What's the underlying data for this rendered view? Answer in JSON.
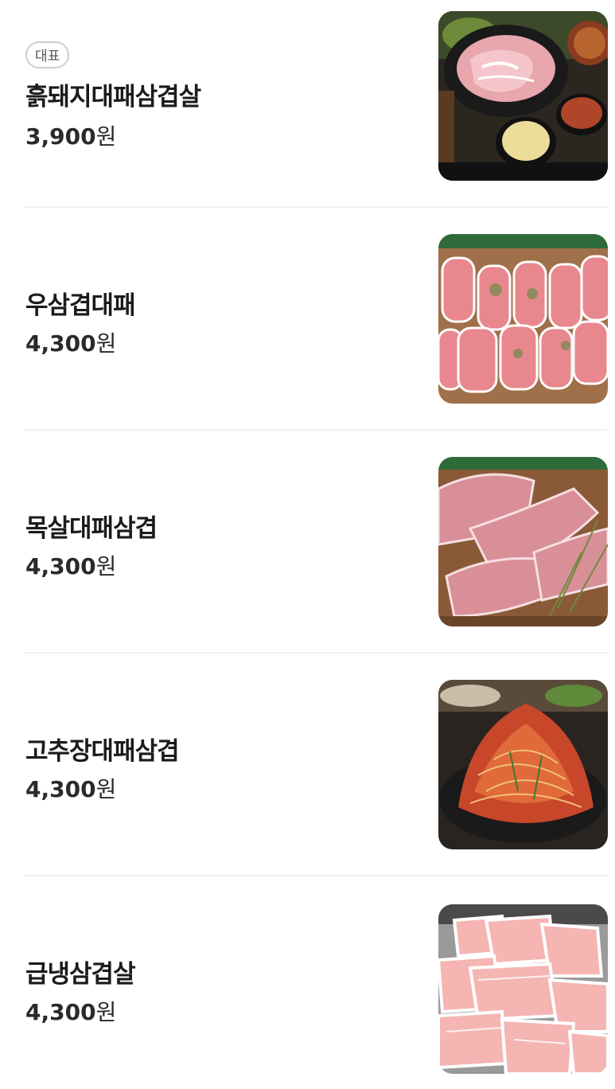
{
  "menu": {
    "items": [
      {
        "badge": "대표",
        "name": "흙돼지대패삼겹살",
        "price": "3,900",
        "unit": "원",
        "image": "pork-platter-with-stew-photo"
      },
      {
        "name": "우삼겹대패",
        "price": "4,300",
        "unit": "원",
        "image": "rolled-beef-brisket-photo"
      },
      {
        "name": "목살대패삼겹",
        "price": "4,300",
        "unit": "원",
        "image": "pork-neck-slices-photo"
      },
      {
        "name": "고추장대패삼겹",
        "price": "4,300",
        "unit": "원",
        "image": "spicy-gochujang-pork-photo"
      },
      {
        "name": "급냉삼겹살",
        "price": "4,300",
        "unit": "원",
        "image": "frozen-pork-belly-photo"
      }
    ]
  },
  "colors": {
    "text": "#1b1b1b",
    "divider": "#f1f1f1",
    "badge_border": "#cfcfcf"
  }
}
